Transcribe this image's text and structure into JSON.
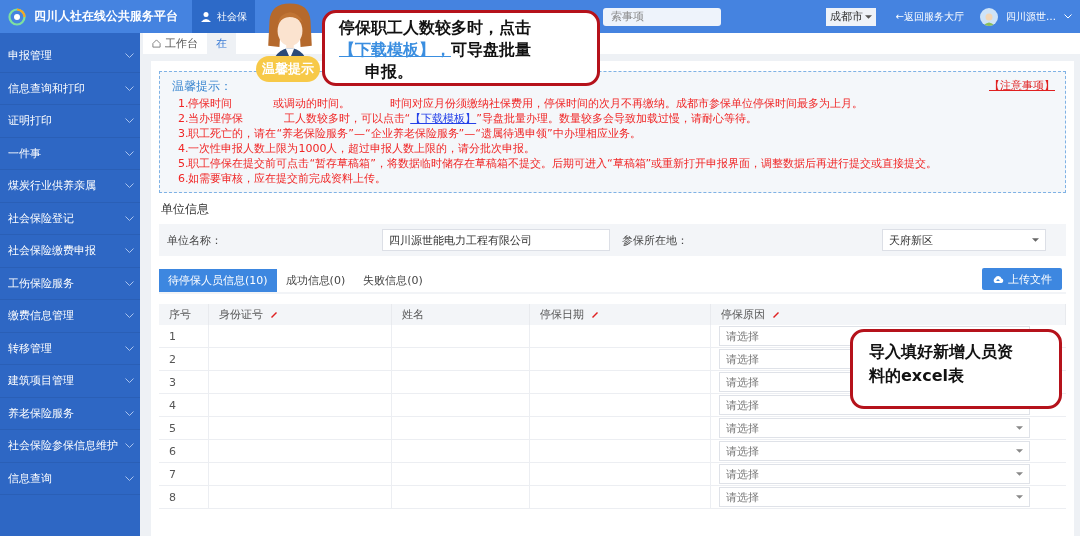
{
  "header": {
    "title": "四川人社在线公共服务平台",
    "nav_tab": "社会保",
    "search": "索事项",
    "city": "成都市",
    "back_link": "←返回服务大厅",
    "user": "四川源世…"
  },
  "sidebar": {
    "items": [
      {
        "label": "申报管理"
      },
      {
        "label": "信息查询和打印"
      },
      {
        "label": "证明打印"
      },
      {
        "label": "一件事"
      },
      {
        "label": "煤炭行业供养亲属"
      },
      {
        "label": "社会保险登记"
      },
      {
        "label": "社会保险缴费申报"
      },
      {
        "label": "工伤保险服务"
      },
      {
        "label": "缴费信息管理"
      },
      {
        "label": "转移管理"
      },
      {
        "label": "建筑项目管理"
      },
      {
        "label": "养老保险服务"
      },
      {
        "label": "社会保险参保信息维护"
      },
      {
        "label": "信息查询"
      }
    ]
  },
  "breadcrumb": [
    {
      "label": "工作台",
      "selected": false
    },
    {
      "label": "在",
      "selected": true
    }
  ],
  "notice": {
    "title": "温馨提示：",
    "link": "【注意事项】",
    "lines": [
      {
        "parts": [
          {
            "kind": "text",
            "text": "1.停保时间"
          },
          {
            "kind": "text",
            "text": "或调动的时间。"
          },
          {
            "kind": "text",
            "text": "时间对应月份须缴纳社保费用，停保时间的次月不再缴纳。成都市参保单位停保时间最多为上月。"
          }
        ]
      },
      {
        "parts": [
          {
            "kind": "text",
            "text": "2.当办理停保"
          },
          {
            "kind": "text",
            "text": "工人数较多时，可以点击“"
          },
          {
            "kind": "link",
            "text": "【下载模板】"
          },
          {
            "kind": "text",
            "text": "”导盘批量办理。数量较多会导致加载过慢，请耐心等待。"
          }
        ]
      },
      {
        "parts": [
          {
            "kind": "text",
            "text": "3.职工死亡的，请在“养老保险服务”—“企业养老保险服务”—“遗属待遇申领”中办理相应业务。"
          }
        ]
      },
      {
        "parts": [
          {
            "kind": "text",
            "text": "4.一次性申报人数上限为1000人，超过申报人数上限的，请分批次申报。"
          }
        ]
      },
      {
        "parts": [
          {
            "kind": "text",
            "text": "5.职工停保在提交前可点击“暂存草稿箱”，将数据临时储存在草稿箱不提交。后期可进入“草稿箱”或重新打开申报界面，调整数据后再进行提交或直接提交。"
          }
        ]
      },
      {
        "parts": [
          {
            "kind": "text",
            "text": "6.如需要审核，应在提交前完成资料上传。"
          }
        ]
      }
    ]
  },
  "unit_info": {
    "heading": "单位信息",
    "fields": [
      {
        "kind": "input",
        "label": "单位名称：",
        "value": "四川源世能电力工程有限公司"
      },
      {
        "kind": "select",
        "label": "参保所在地：",
        "value": "天府新区"
      }
    ]
  },
  "tabs": [
    {
      "label": "待停保人员信息(10)",
      "selected": true
    },
    {
      "label": "成功信息(0)",
      "selected": false
    },
    {
      "label": "失败信息(0)",
      "selected": false
    }
  ],
  "upload_button": "上传文件",
  "table": {
    "columns": [
      {
        "label": "序号",
        "editable": false
      },
      {
        "label": "身份证号",
        "editable": true
      },
      {
        "label": "姓名",
        "editable": false
      },
      {
        "label": "停保日期",
        "editable": true
      },
      {
        "label": "停保原因",
        "editable": true
      }
    ],
    "rows": [
      {
        "index": "1",
        "reason": "请选择"
      },
      {
        "index": "2",
        "reason": "请选择"
      },
      {
        "index": "3",
        "reason": "请选择"
      },
      {
        "index": "4",
        "reason": "请选择"
      },
      {
        "index": "5",
        "reason": "请选择"
      },
      {
        "index": "6",
        "reason": "请选择"
      },
      {
        "index": "7",
        "reason": "请选择"
      },
      {
        "index": "8",
        "reason": "请选择"
      }
    ]
  },
  "callouts": [
    {
      "sticker": "温馨提示",
      "lines": [
        [
          {
            "kind": "text",
            "text": "停保职工人数较多时，点击"
          }
        ],
        [
          {
            "kind": "link",
            "text": "【下载模板】，"
          },
          {
            "kind": "text",
            "text": "可导盘批量"
          }
        ],
        [
          {
            "kind": "text",
            "text": "申报。"
          }
        ]
      ]
    },
    {
      "lines": [
        [
          {
            "kind": "text",
            "text": "导入填好新增人员资"
          }
        ],
        [
          {
            "kind": "text",
            "text": "料的excel表"
          }
        ]
      ]
    }
  ]
}
